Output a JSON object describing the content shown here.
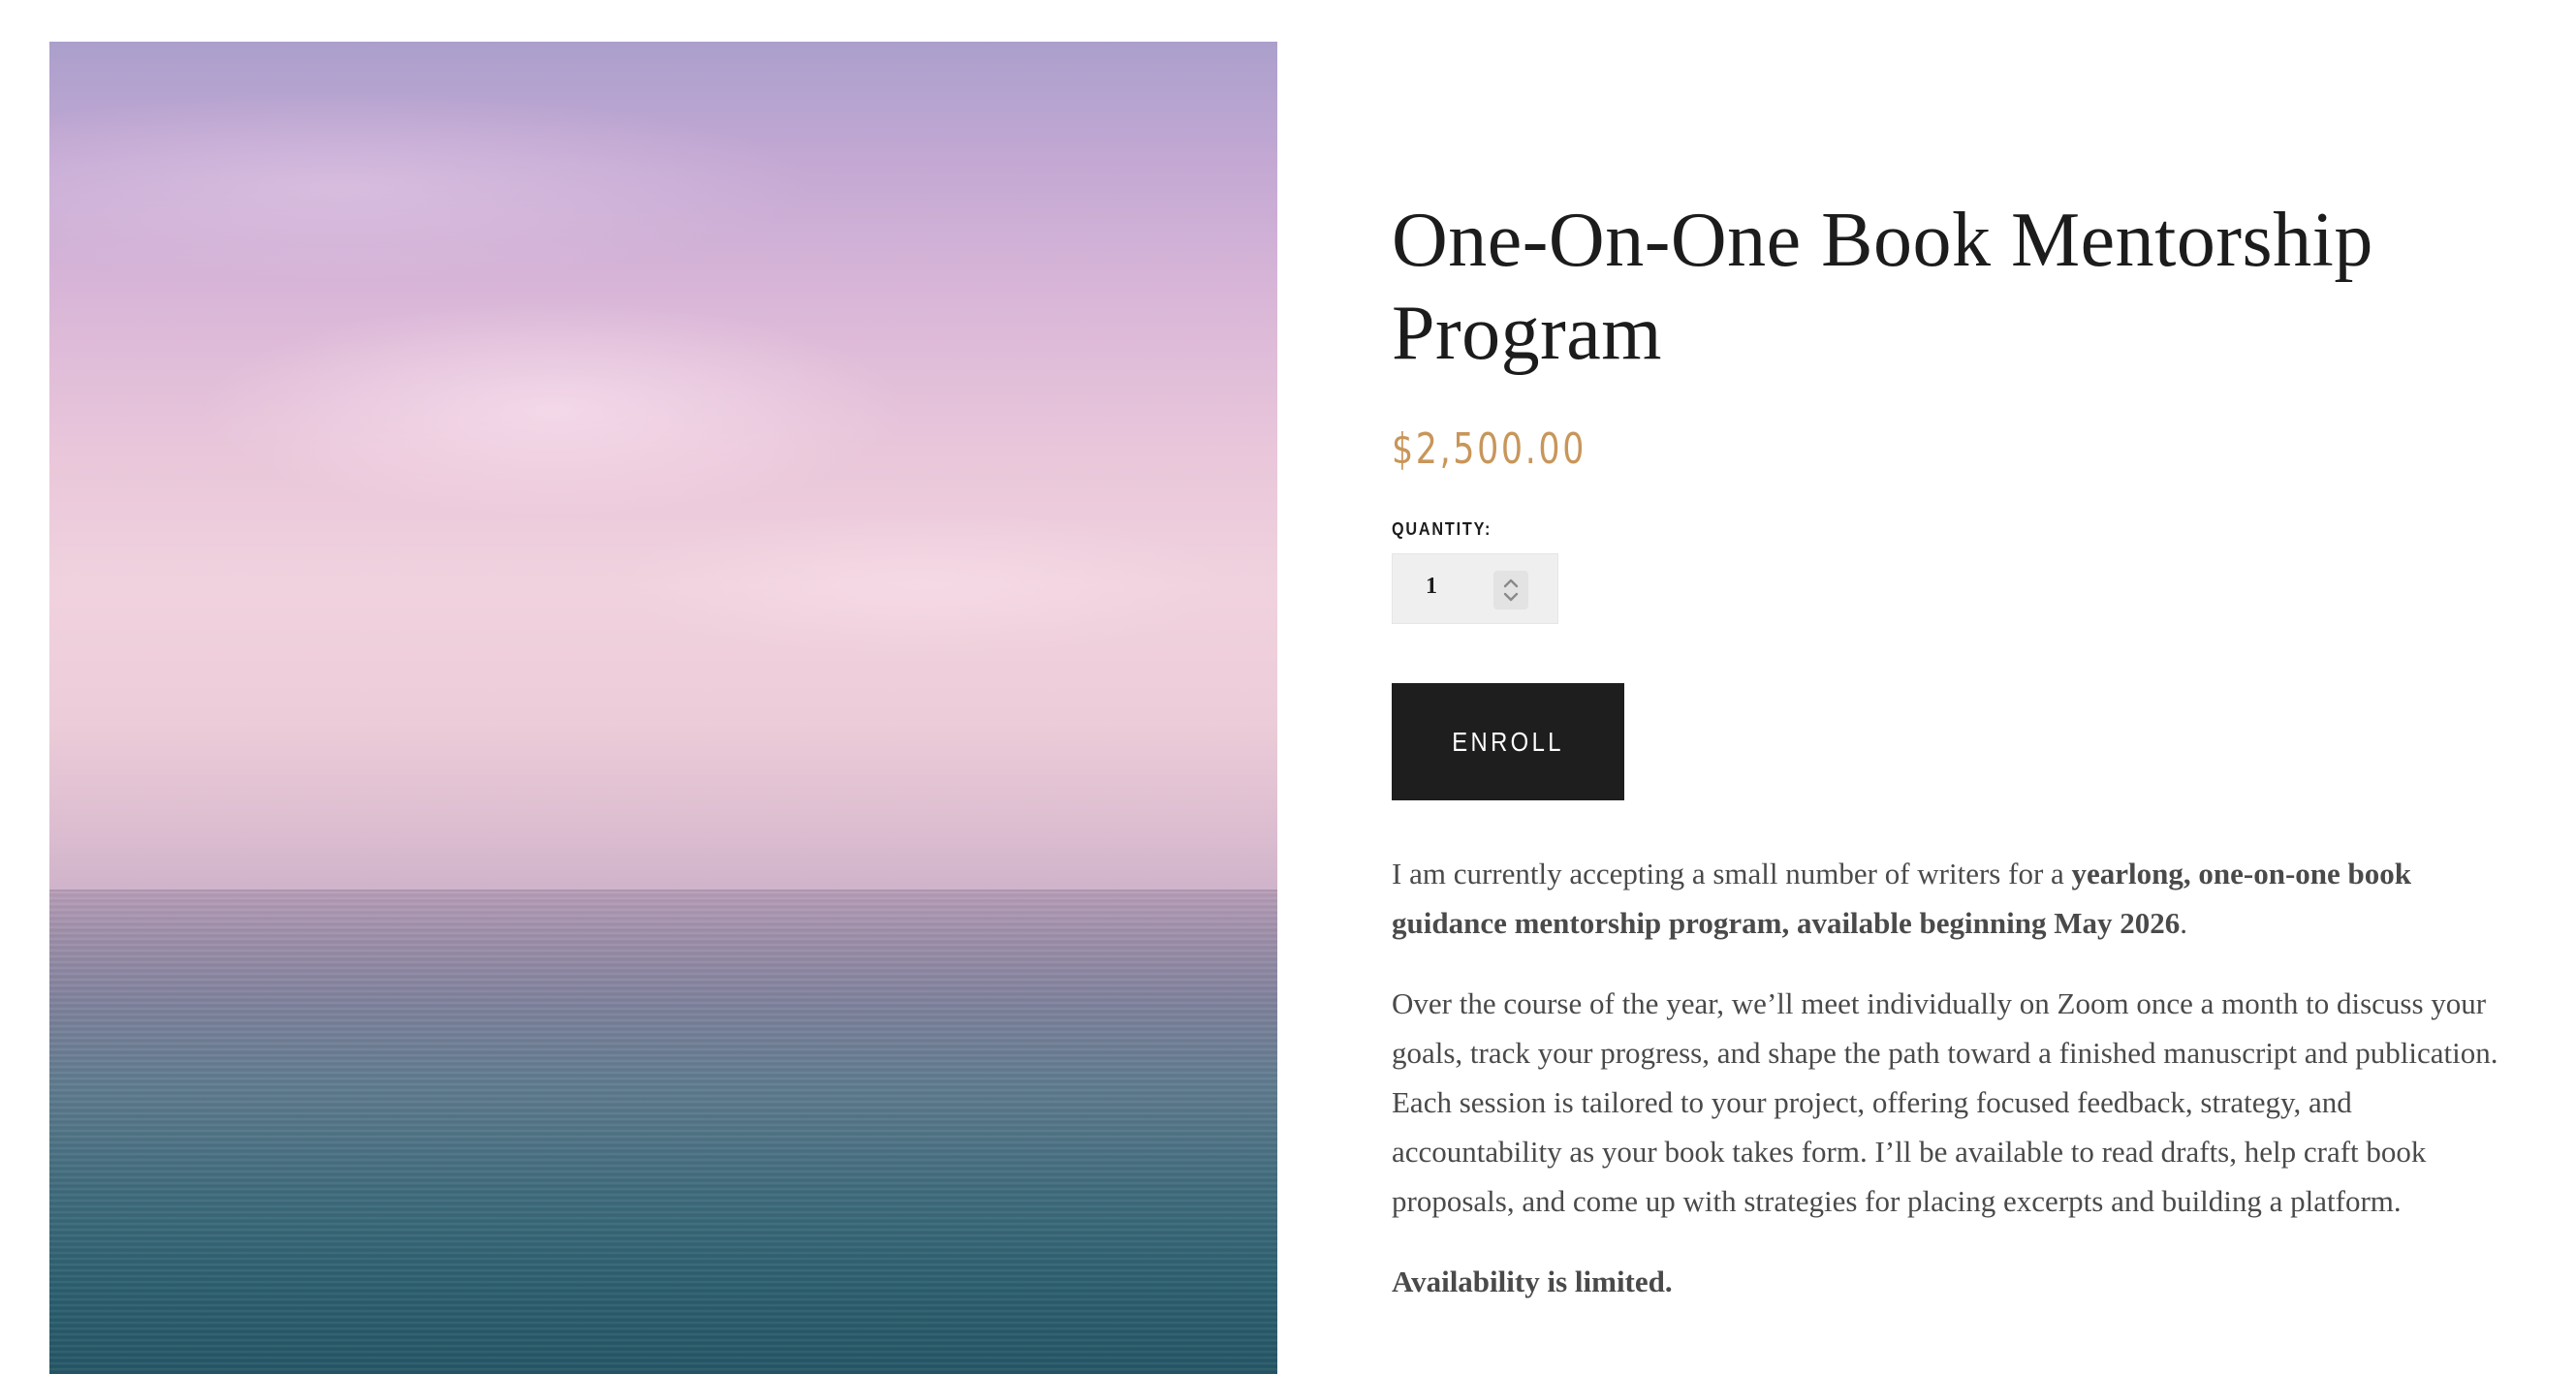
{
  "product": {
    "image_alt": "Pastel purple sky over a calm ocean",
    "title": "One-On-One Book Mentorship Program",
    "price": "$2,500.00"
  },
  "quantity": {
    "label": "QUANTITY:",
    "value": "1"
  },
  "enroll": {
    "label": "ENROLL"
  },
  "description": {
    "p1_lead": "I am currently accepting a small number of writers for a ",
    "p1_bold": "yearlong, one-on-one book guidance mentorship program, available beginning May 2026",
    "p1_tail": ".",
    "p2": "Over the course of the year, we’ll meet individually on Zoom once a month to discuss your goals, track your progress, and shape the path toward a finished manuscript and publication. Each session is tailored to your project, offering focused feedback, strategy, and accountability as your book takes form. I’ll be available to read drafts, help craft book proposals, and come up with strategies for placing excerpts and building a platform.",
    "p3_bold": "Availability is limited."
  },
  "colors": {
    "price": "#c8965a",
    "button_bg": "#1e1e1e",
    "text": "#4a4a4a",
    "title": "#1c1c1c"
  }
}
